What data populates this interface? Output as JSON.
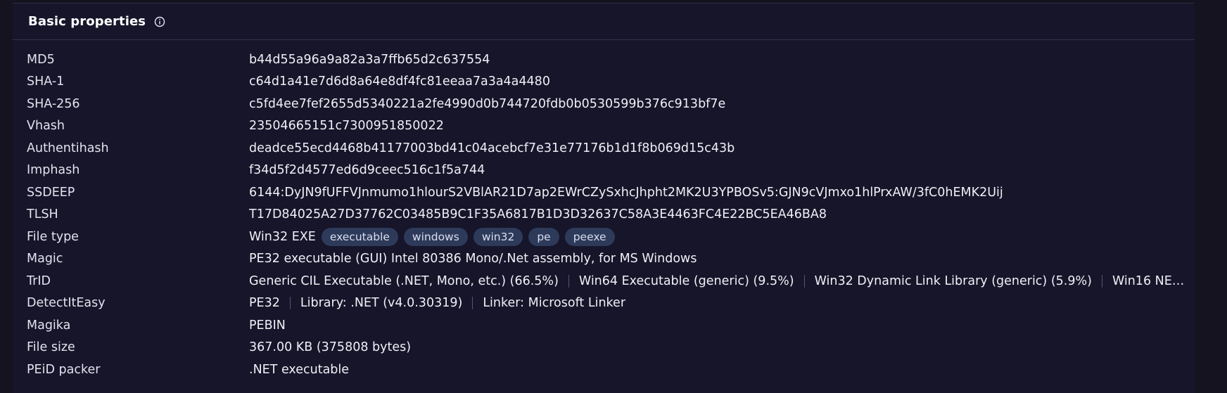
{
  "header": {
    "title": "Basic properties",
    "info_icon": "info-circle-icon"
  },
  "rows": {
    "md5": {
      "label": "MD5",
      "value": "b44d55a96a9a82a3a7ffb65d2c637554"
    },
    "sha1": {
      "label": "SHA-1",
      "value": "c64d1a41e7d6d8a64e8df4fc81eeaa7a3a4a4480"
    },
    "sha256": {
      "label": "SHA-256",
      "value": "c5fd4ee7fef2655d5340221a2fe4990d0b744720fdb0b0530599b376c913bf7e"
    },
    "vhash": {
      "label": "Vhash",
      "value": "23504665151c7300951850022"
    },
    "authentihash": {
      "label": "Authentihash",
      "value": "deadce55ecd4468b41177003bd41c04acebcf7e31e77176b1d1f8b069d15c43b"
    },
    "imphash": {
      "label": "Imphash",
      "value": "f34d5f2d4577ed6d9ceec516c1f5a744"
    },
    "ssdeep": {
      "label": "SSDEEP",
      "value": "6144:DyJN9fUFFVJnmumo1hlourS2VBlAR21D7ap2EWrCZySxhcJhpht2MK2U3YPBOSv5:GJN9cVJmxo1hlPrxAW/3fC0hEMK2Uij"
    },
    "tlsh": {
      "label": "TLSH",
      "value": "T17D84025A27D37762C03485B9C1F35A6817B1D3D32637C58A3E4463FC4E22BC5EA46BA8"
    },
    "file_type": {
      "label": "File type",
      "value": "Win32 EXE",
      "tags": [
        "executable",
        "windows",
        "win32",
        "pe",
        "peexe"
      ]
    },
    "magic": {
      "label": "Magic",
      "value": "PE32 executable (GUI) Intel 80386 Mono/.Net assembly, for MS Windows"
    },
    "trid": {
      "label": "TrID",
      "values": [
        "Generic CIL Executable (.NET, Mono, etc.) (66.5%)",
        "Win64 Executable (generic) (9.5%)",
        "Win32 Dynamic Link Library (generic) (5.9%)",
        "Win16 NE…"
      ]
    },
    "detectiteasy": {
      "label": "DetectItEasy",
      "values": [
        "PE32",
        "Library: .NET (v4.0.30319)",
        "Linker: Microsoft Linker"
      ]
    },
    "magika": {
      "label": "Magika",
      "value": "PEBIN"
    },
    "file_size": {
      "label": "File size",
      "value": "367.00 KB (375808 bytes)"
    },
    "peid": {
      "label": "PEiD packer",
      "value": ".NET executable"
    }
  }
}
